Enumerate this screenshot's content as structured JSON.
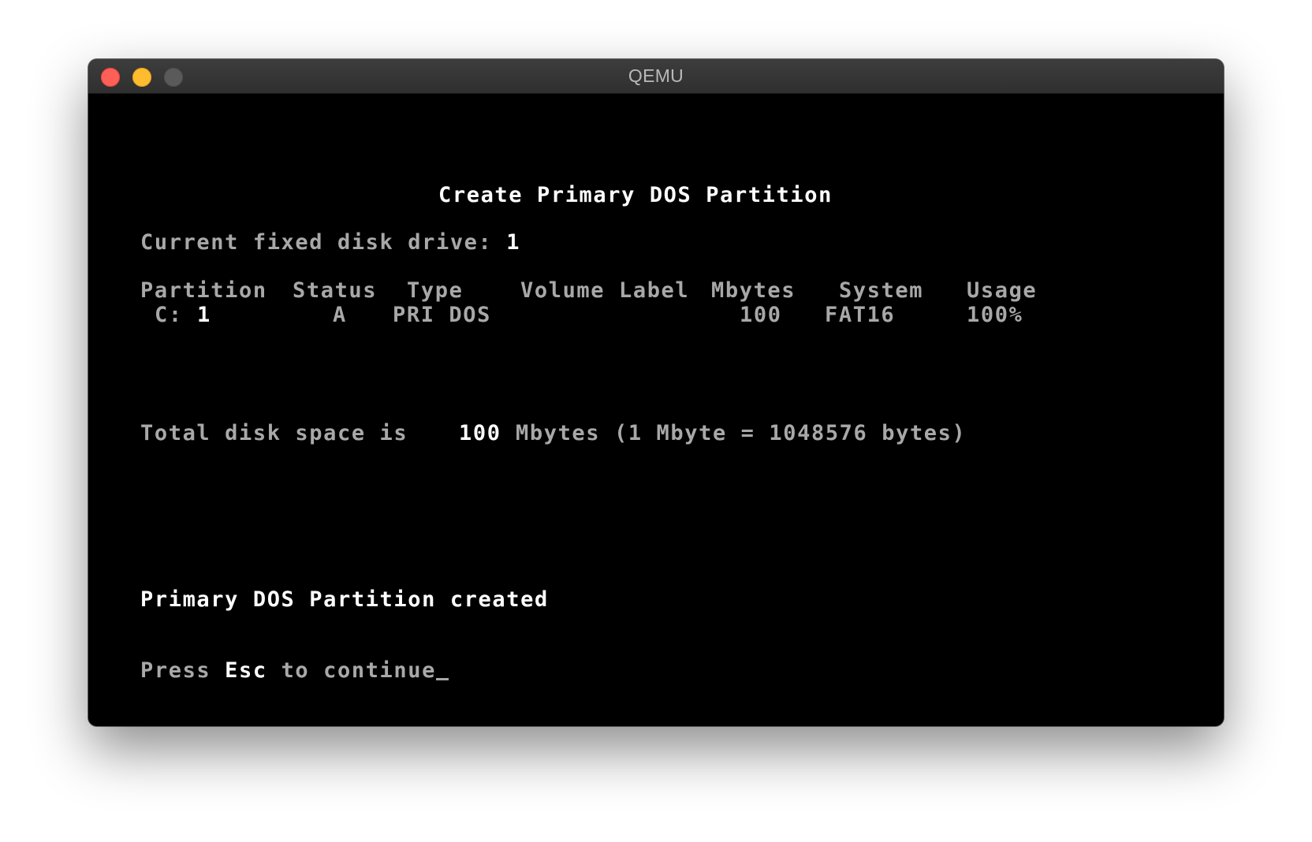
{
  "window": {
    "title": "QEMU"
  },
  "screen": {
    "heading": "Create Primary DOS Partition",
    "drive_label": "Current fixed disk drive: ",
    "drive_value": "1",
    "table": {
      "headers": {
        "partition": "Partition",
        "status": "Status",
        "type": "Type",
        "volume_label": "Volume Label",
        "mbytes": "Mbytes",
        "system": "System",
        "usage": "Usage"
      },
      "rows": [
        {
          "drive": "C:",
          "partition": "1",
          "status": "A",
          "type": "PRI DOS",
          "volume_label": "",
          "mbytes": "100",
          "system": "FAT16",
          "usage": "100%"
        }
      ]
    },
    "total_label": "Total disk space is",
    "total_value": "100",
    "total_suffix": "Mbytes (1 Mbyte = 1048576 bytes)",
    "message": "Primary DOS Partition created",
    "prompt_press": "Press ",
    "prompt_key": "Esc",
    "prompt_rest": " to continue"
  },
  "colors": {
    "text_normal": "#a8a8a8",
    "text_highlight": "#ffffff",
    "background": "#000000",
    "titlebar": "#363636",
    "close": "#fe5f57",
    "minimize": "#febc2e",
    "maximize_inactive": "#5a5a5a"
  }
}
